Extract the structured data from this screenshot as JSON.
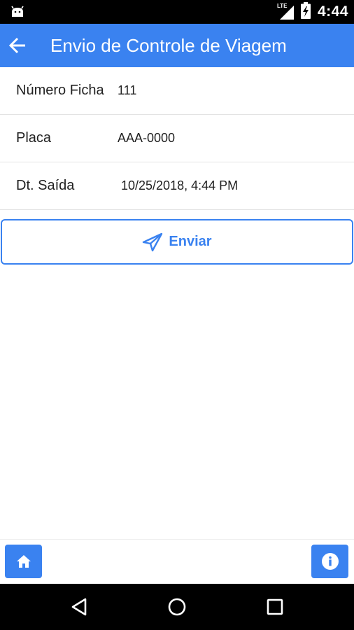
{
  "status_bar": {
    "network_label": "LTE",
    "time": "4:44"
  },
  "app_bar": {
    "title": "Envio de Controle de Viagem"
  },
  "form": {
    "rows": [
      {
        "label": "Número Ficha",
        "value": "111"
      },
      {
        "label": "Placa",
        "value": "AAA-0000"
      },
      {
        "label": "Dt. Saída",
        "value": " 10/25/2018, 4:44 PM"
      }
    ]
  },
  "actions": {
    "send_label": "Enviar"
  },
  "colors": {
    "primary": "#3a82f0",
    "status_bar": "#000000",
    "nav_bar": "#000000"
  },
  "icons": {
    "status_app": "android-icon",
    "signal": "signal-icon",
    "battery": "battery-icon",
    "back": "arrow-left-icon",
    "send": "paper-plane-icon",
    "home": "home-icon",
    "info": "info-icon",
    "nav_back": "triangle-back-icon",
    "nav_home": "circle-home-icon",
    "nav_recent": "square-recent-icon"
  }
}
